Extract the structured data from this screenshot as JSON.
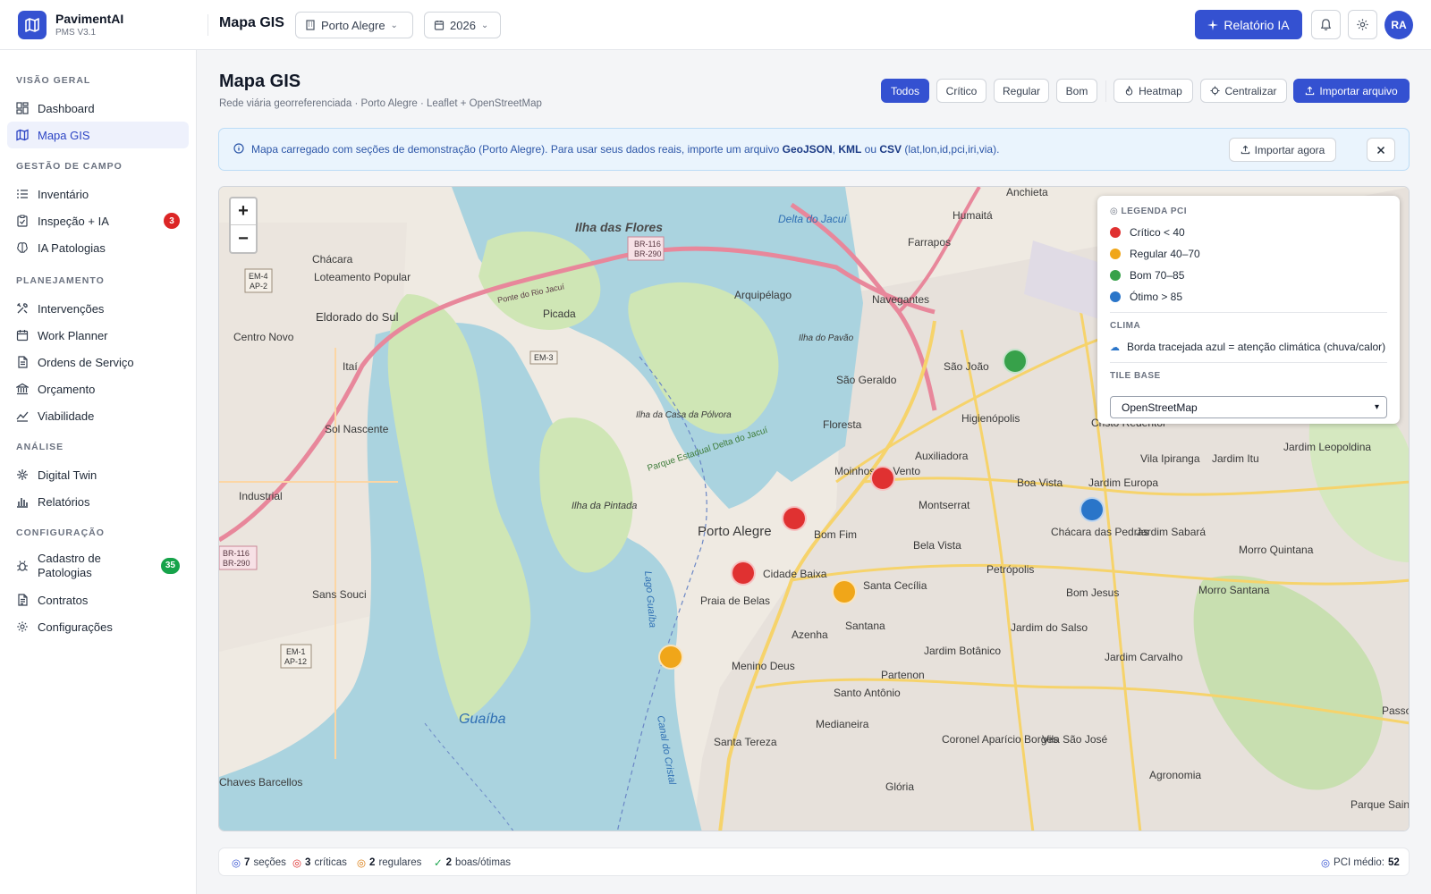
{
  "app": {
    "name": "PavimentAI",
    "version": "PMS V3.1"
  },
  "header": {
    "title": "Mapa GIS",
    "city": "Porto Alegre",
    "year": "2026",
    "report_button": "Relatório IA",
    "avatar_initials": "RA"
  },
  "sidebar": {
    "sections": [
      {
        "label": "VISÃO GERAL"
      },
      {
        "label": "GESTÃO DE CAMPO"
      },
      {
        "label": "PLANEJAMENTO"
      },
      {
        "label": "ANÁLISE"
      },
      {
        "label": "CONFIGURAÇÃO"
      }
    ],
    "items": [
      {
        "label": "Dashboard",
        "icon": "dashboard-icon"
      },
      {
        "label": "Mapa GIS",
        "icon": "map-icon",
        "active": true
      },
      {
        "label": "Inventário",
        "icon": "list-icon"
      },
      {
        "label": "Inspeção + IA",
        "icon": "clipboard-icon",
        "badge": "3",
        "badge_color": "#dc2626"
      },
      {
        "label": "IA Patologias",
        "icon": "brain-icon"
      },
      {
        "label": "Intervenções",
        "icon": "tools-icon"
      },
      {
        "label": "Work Planner",
        "icon": "calendar-icon"
      },
      {
        "label": "Ordens de Serviço",
        "icon": "document-icon"
      },
      {
        "label": "Orçamento",
        "icon": "bank-icon"
      },
      {
        "label": "Viabilidade",
        "icon": "trend-icon"
      },
      {
        "label": "Digital Twin",
        "icon": "digital-twin-icon"
      },
      {
        "label": "Relatórios",
        "icon": "bar-chart-icon"
      },
      {
        "label": "Cadastro de Patologias",
        "icon": "bug-icon",
        "badge": "35",
        "badge_color": "#16a34a"
      },
      {
        "label": "Contratos",
        "icon": "contract-icon"
      },
      {
        "label": "Configurações",
        "icon": "gear-icon"
      }
    ]
  },
  "main": {
    "title": "Mapa GIS",
    "subtitle": "Rede viária georreferenciada · Porto Alegre · Leaflet + OpenStreetMap",
    "filters": [
      {
        "label": "Todos",
        "active": true
      },
      {
        "label": "Crítico"
      },
      {
        "label": "Regular"
      },
      {
        "label": "Bom"
      }
    ],
    "heatmap_button": "Heatmap",
    "center_button": "Centralizar",
    "import_button": "Importar arquivo"
  },
  "banner": {
    "text_before": "Mapa carregado com seções de demonstração (Porto Alegre). Para usar seus dados reais, importe um arquivo ",
    "fmt_geojson": "GeoJSON",
    "sep1": ", ",
    "fmt_kml": "KML",
    "sep2": " ou ",
    "fmt_csv": "CSV",
    "text_after": " (lat,lon,id,pci,iri,via).",
    "import_now": "Importar agora"
  },
  "map": {
    "zoom_in": "+",
    "zoom_out": "−",
    "labels": {
      "ilha_flores": "Ilha das Flores",
      "porto_alegre": "Porto Alegre",
      "guaiba": "Guaíba",
      "delta": "Delta do Jacuí",
      "chacara": "Chácara",
      "loteamento": "Loteamento Popular",
      "eldorado": "Eldorado do Sul",
      "centro_novo": "Centro Novo",
      "picada": "Picada",
      "itai": "Itaí",
      "sol_nascente": "Sol Nascente",
      "industrial": "Industrial",
      "sans_souci": "Sans Souci",
      "chaves": "Chaves Barcellos",
      "arquipelago": "Arquipélago",
      "ilha_pavao": "Ilha do Pavão",
      "ilha_casa": "Ilha da Casa da Pólvora",
      "ilha_pintada": "Ilha da Pintada",
      "humaita": "Humaitá",
      "farrapos": "Farrapos",
      "navegantes": "Navegantes",
      "anchieta": "Anchieta",
      "sao_joao": "São João",
      "sao_geraldo": "São Geraldo",
      "higienopolis": "Higienópolis",
      "floresta": "Floresta",
      "cristo": "Cristo Redentor",
      "auxiliadora": "Auxiliadora",
      "moinhos": "Moinhos de Vento",
      "montserrat": "Montserrat",
      "boa_vista": "Boa Vista",
      "jardim_europa": "Jardim Europa",
      "vila_ipiranga": "Vila Ipiranga",
      "jardim_itu": "Jardim Itu",
      "jardim_leopoldina": "Jardim Leopoldina",
      "bom_fim": "Bom Fim",
      "bela_vista": "Bela Vista",
      "chacara_pedras": "Chácara das Pedras",
      "jardim_sabara": "Jardim Sabará",
      "morro_quintana": "Morro Quintana",
      "cidade_baixa": "Cidade Baixa",
      "petropolis": "Petrópolis",
      "santa_cecilia": "Santa Cecília",
      "bom_jesus": "Bom Jesus",
      "morro_santana": "Morro Santana",
      "praia_belas": "Praia de Belas",
      "santana": "Santana",
      "jardim_salso": "Jardim do Salso",
      "azenha": "Azenha",
      "menino_deus": "Menino Deus",
      "jardim_botanico": "Jardim Botânico",
      "jardim_carvalho": "Jardim Carvalho",
      "partenon": "Partenon",
      "santo_antonio": "Santo Antônio",
      "medianeira": "Medianeira",
      "coronel": "Coronel Aparício Borges",
      "vila_sao_jose": "Vila São José",
      "santa_tereza": "Santa Tereza",
      "gloria": "Glória",
      "agronomia": "Agronomia",
      "passo_dorneles": "Passo d",
      "parque_saint": "Parque Saint Hilaire",
      "canal_cristal": "Canal do Cristal",
      "lago_guaiba": "Lago Guaíba",
      "road_br116": "BR-116",
      "road_br290": "BR-290",
      "road_em3": "EM-3",
      "road_em4": "EM-4",
      "road_ap2": "AP-2",
      "road_em1": "EM-1",
      "road_ap12": "AP-12",
      "ponte": "Ponte do Rio Jacuí",
      "parque_delta": "Parque Estadual Delta do Jacuí"
    }
  },
  "legend": {
    "title": "LEGENDA PCI",
    "items": [
      {
        "label": "Crítico < 40",
        "color": "#e03131"
      },
      {
        "label": "Regular 40–70",
        "color": "#f0a619"
      },
      {
        "label": "Bom 70–85",
        "color": "#37a14a"
      },
      {
        "label": "Ótimo > 85",
        "color": "#2a75c9"
      }
    ],
    "climate_title": "CLIMA",
    "climate_text": "Borda tracejada azul = atenção climática (chuva/calor)",
    "tile_title": "TILE BASE",
    "tile_value": "OpenStreetMap"
  },
  "markers": [
    {
      "pci_class": "bom",
      "color": "#37a14a"
    },
    {
      "pci_class": "critico",
      "color": "#e03131"
    },
    {
      "pci_class": "otimo",
      "color": "#2a75c9"
    },
    {
      "pci_class": "critico",
      "color": "#e03131"
    },
    {
      "pci_class": "critico",
      "color": "#e03131"
    },
    {
      "pci_class": "regular",
      "color": "#f0a619"
    },
    {
      "pci_class": "regular",
      "color": "#f0a619"
    }
  ],
  "status": {
    "sections_count": "7",
    "sections_label": "seções",
    "critical_count": "3",
    "critical_label": "críticas",
    "regular_count": "2",
    "regular_label": "regulares",
    "good_count": "2",
    "good_label": "boas/ótimas",
    "pci_label": "PCI médio:",
    "pci_value": "52"
  }
}
